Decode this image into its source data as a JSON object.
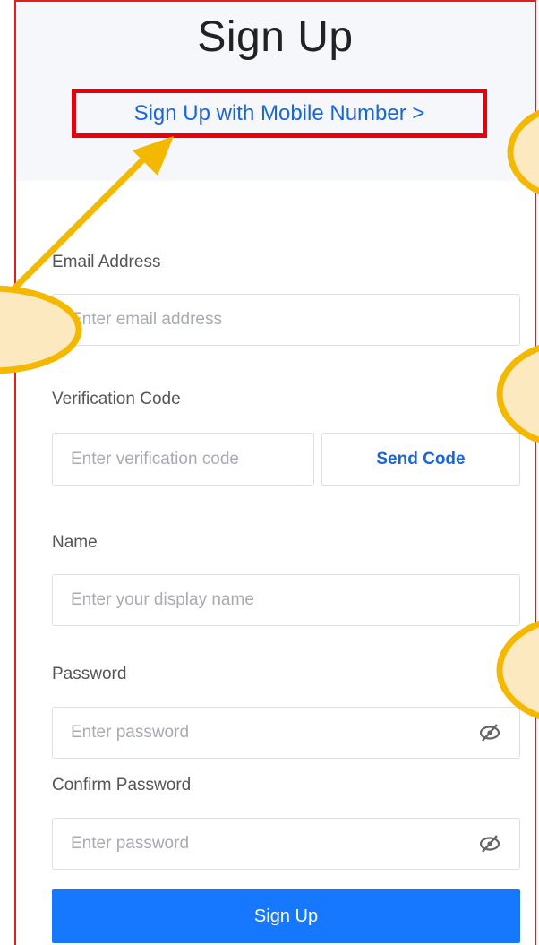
{
  "header": {
    "title": "Sign Up",
    "mobile_link": "Sign Up with Mobile Number >"
  },
  "form": {
    "email_label": "Email Address",
    "email_placeholder": "Enter email address",
    "code_label": "Verification Code",
    "code_placeholder": "Enter verification code",
    "send_code_label": "Send Code",
    "name_label": "Name",
    "name_placeholder": "Enter your display name",
    "password_label": "Password",
    "password_placeholder": "Enter password",
    "confirm_label": "Confirm Password",
    "confirm_placeholder": "Enter password",
    "submit_label": "Sign Up"
  },
  "colors": {
    "accent": "#1677ff",
    "link": "#1a66d9",
    "highlight_box": "#e8000b",
    "annotation": "#f5b800",
    "annotation_fill": "#fde9c0"
  },
  "icons": {
    "password_toggle": "eye-slash-icon"
  }
}
